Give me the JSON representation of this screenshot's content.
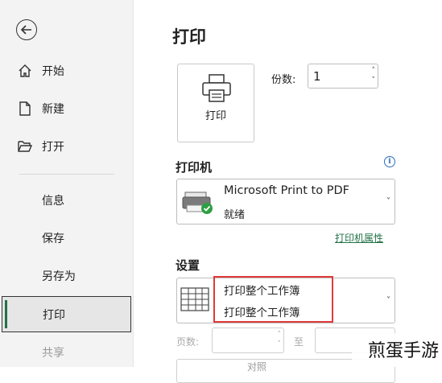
{
  "sidebar": {
    "items": [
      {
        "label": "开始",
        "icon": "home-icon"
      },
      {
        "label": "新建",
        "icon": "new-file-icon"
      },
      {
        "label": "打开",
        "icon": "folder-open-icon"
      },
      {
        "label": "信息"
      },
      {
        "label": "保存"
      },
      {
        "label": "另存为"
      },
      {
        "label": "打印"
      },
      {
        "label": "共享"
      }
    ],
    "active": "打印"
  },
  "main": {
    "title": "打印",
    "print_button": "打印",
    "copies": {
      "label": "份数:",
      "value": "1"
    },
    "printer": {
      "heading": "打印机",
      "name": "Microsoft Print to PDF",
      "status": "就绪",
      "properties_link": "打印机属性"
    },
    "settings": {
      "heading": "设置",
      "option_title": "打印整个工作簿",
      "option_desc": "打印整个工作簿"
    },
    "pages": {
      "label": "页数:",
      "to": "至"
    },
    "collate_partial": "对照"
  },
  "watermark": "煎蛋手游",
  "colors": {
    "accent": "#217346",
    "highlight": "#e03a3a",
    "info": "#2a6ebb"
  }
}
